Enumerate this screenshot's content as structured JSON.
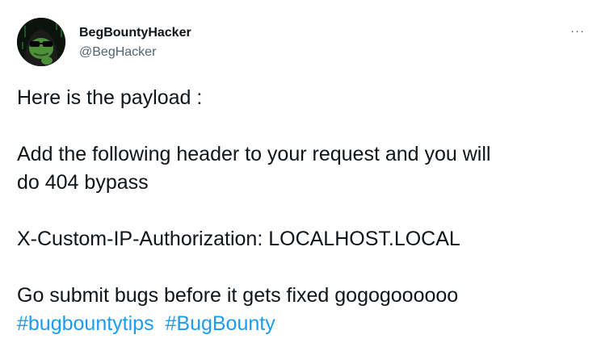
{
  "author": {
    "display_name": "BegBountyHacker",
    "handle": "@BegHacker",
    "avatar_icon": "hacker-frog-hooded-avatar"
  },
  "menu": {
    "more_label": "···",
    "more_icon": "more-options-icon"
  },
  "tweet": {
    "line_1": "Here is the payload :",
    "line_2": "Add the following header to your request and you will",
    "line_3": "do 404 bypass",
    "line_4": "X-Custom-IP-Authorization: LOCALHOST.LOCAL",
    "line_5": "Go submit bugs before it gets fixed gogogoooooo",
    "hashtags": [
      "#bugbountytips",
      "#BugBounty"
    ]
  },
  "colors": {
    "text": "#0f1419",
    "secondary": "#536471",
    "link": "#1d9bf0",
    "background": "#ffffff"
  }
}
